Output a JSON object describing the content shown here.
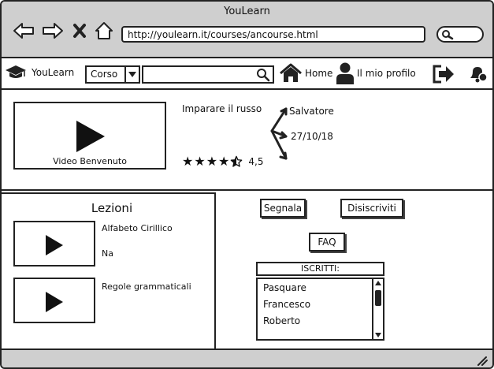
{
  "window": {
    "title": "YouLearn"
  },
  "browser": {
    "url": "http://youlearn.it/courses/ancourse.html",
    "icons": [
      "back-arrow-icon",
      "forward-arrow-icon",
      "close-x-icon",
      "home-outline-icon",
      "search-icon"
    ]
  },
  "nav": {
    "brand": "YouLearn",
    "select_value": "Corso",
    "home_label": "Home",
    "profile_label": "Il mio profilo"
  },
  "course": {
    "video_caption": "Video Benvenuto",
    "title": "Imparare il russo",
    "author": "Salvatore",
    "date": "27/10/18",
    "rating_value": "4,5",
    "rating_stars": 4.5
  },
  "lessons": {
    "title": "Lezioni",
    "items": [
      {
        "title": "Alfabeto Cirillico",
        "subtitle": "Na"
      },
      {
        "title": "Regole grammaticali",
        "subtitle": ""
      }
    ]
  },
  "actions": {
    "report_label": "Segnala",
    "unsubscribe_label": "Disiscriviti",
    "faq_label": "FAQ"
  },
  "iscritti": {
    "header": "ISCRITTI:",
    "names": [
      "Pasquare",
      "Francesco",
      "Roberto"
    ]
  }
}
